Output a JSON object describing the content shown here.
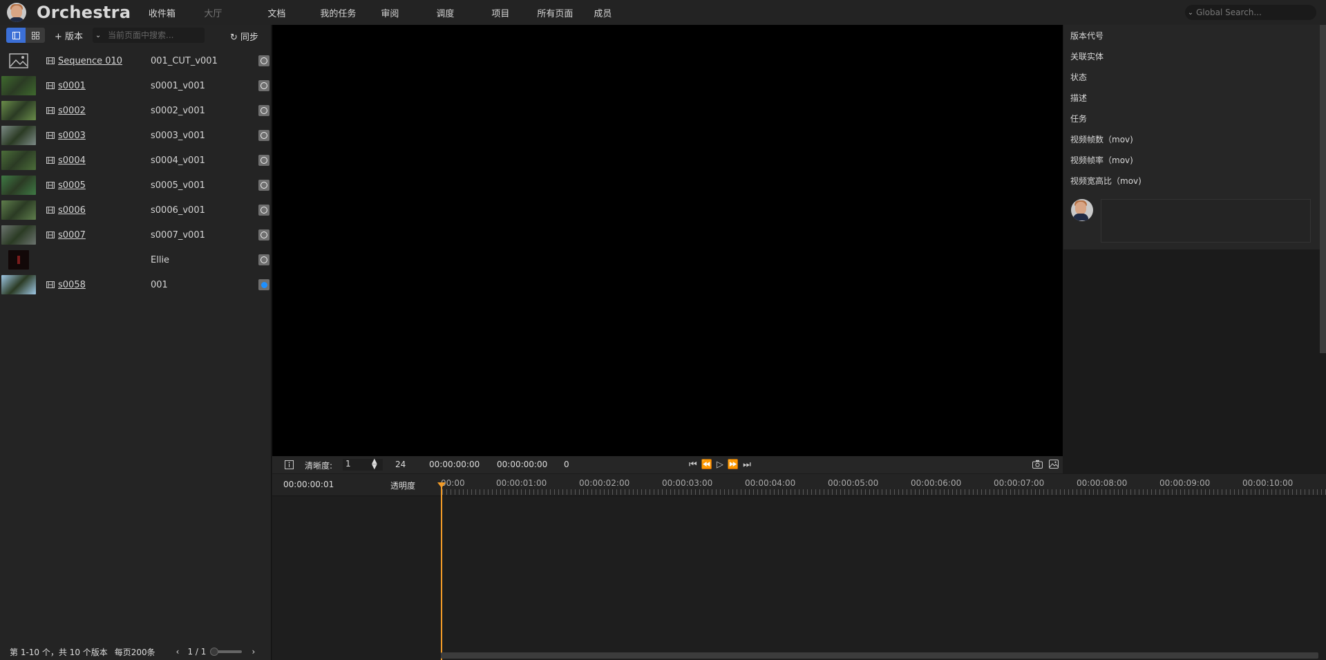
{
  "app": {
    "brand": "Orchestra"
  },
  "nav": [
    {
      "label": "收件箱",
      "dim": false
    },
    {
      "label": "大厅",
      "dim": true
    },
    {
      "label": "文档",
      "dim": false
    },
    {
      "label": "我的任务",
      "dim": false
    },
    {
      "label": "审阅",
      "dim": false
    },
    {
      "label": "调度",
      "dim": false
    },
    {
      "label": "项目",
      "dim": false
    },
    {
      "label": "所有页面",
      "dim": false
    },
    {
      "label": "成员",
      "dim": false
    }
  ],
  "global_search": {
    "placeholder": "Global Search..."
  },
  "left_toolbar": {
    "add_version": "+ 版本",
    "search_placeholder": "当前页面中搜索...",
    "sync": "同步"
  },
  "versions": [
    {
      "name": "Sequence 010",
      "version": "001_CUT_v001",
      "thumb": "placeholder",
      "icon": "sequence-icon",
      "status": "ring"
    },
    {
      "name": "s0001",
      "version": "s0001_v001",
      "thumb": "#3f6a2e",
      "icon": "film-icon",
      "status": "ring"
    },
    {
      "name": "s0002",
      "version": "s0002_v001",
      "thumb": "#6a8d4a",
      "icon": "film-icon",
      "status": "ring"
    },
    {
      "name": "s0003",
      "version": "s0003_v001",
      "thumb": "#7c8a86",
      "icon": "film-icon",
      "status": "ring"
    },
    {
      "name": "s0004",
      "version": "s0004_v001",
      "thumb": "#4c6e3a",
      "icon": "film-icon",
      "status": "ring"
    },
    {
      "name": "s0005",
      "version": "s0005_v001",
      "thumb": "#3f7a45",
      "icon": "film-icon",
      "status": "ring"
    },
    {
      "name": "s0006",
      "version": "s0006_v001",
      "thumb": "#5f7e4c",
      "icon": "film-icon",
      "status": "ring"
    },
    {
      "name": "s0007",
      "version": "s0007_v001",
      "thumb": "#6c7470",
      "icon": "film-icon",
      "status": "ring"
    },
    {
      "name": "",
      "version": "Ellie",
      "thumb": "dark",
      "icon": "",
      "status": "ring"
    },
    {
      "name": "s0058",
      "version": "001",
      "thumb": "#9fc8e6",
      "icon": "film-icon",
      "status": "blue"
    }
  ],
  "left_footer": {
    "summary": "第 1-10 个，共 10 个版本",
    "per_page": "每页200条",
    "page": "1 / 1"
  },
  "player": {
    "quality_label": "清晰度:",
    "quality_value": "1",
    "fps": "24",
    "time_current": "00:00:00:00",
    "time_end": "00:00:00:00",
    "frame": "0"
  },
  "right_panel": {
    "fields": [
      "版本代号",
      "关联实体",
      "状态",
      "描述",
      "任务",
      "视频帧数（mov)",
      "视频帧率（mov)",
      "视频宽高比（mov)"
    ]
  },
  "timeline": {
    "current": "00:00:00:01",
    "opacity_label": "透明度",
    "timecodes": [
      "00:00",
      "00:00:01:00",
      "00:00:02:00",
      "00:00:03:00",
      "00:00:04:00",
      "00:00:05:00",
      "00:00:06:00",
      "00:00:07:00",
      "00:00:08:00",
      "00:00:09:00",
      "00:00:10:00"
    ]
  },
  "colors": {
    "accent": "#3b6fd6",
    "playhead": "#f09a28",
    "status_blue": "#1e90ff"
  }
}
